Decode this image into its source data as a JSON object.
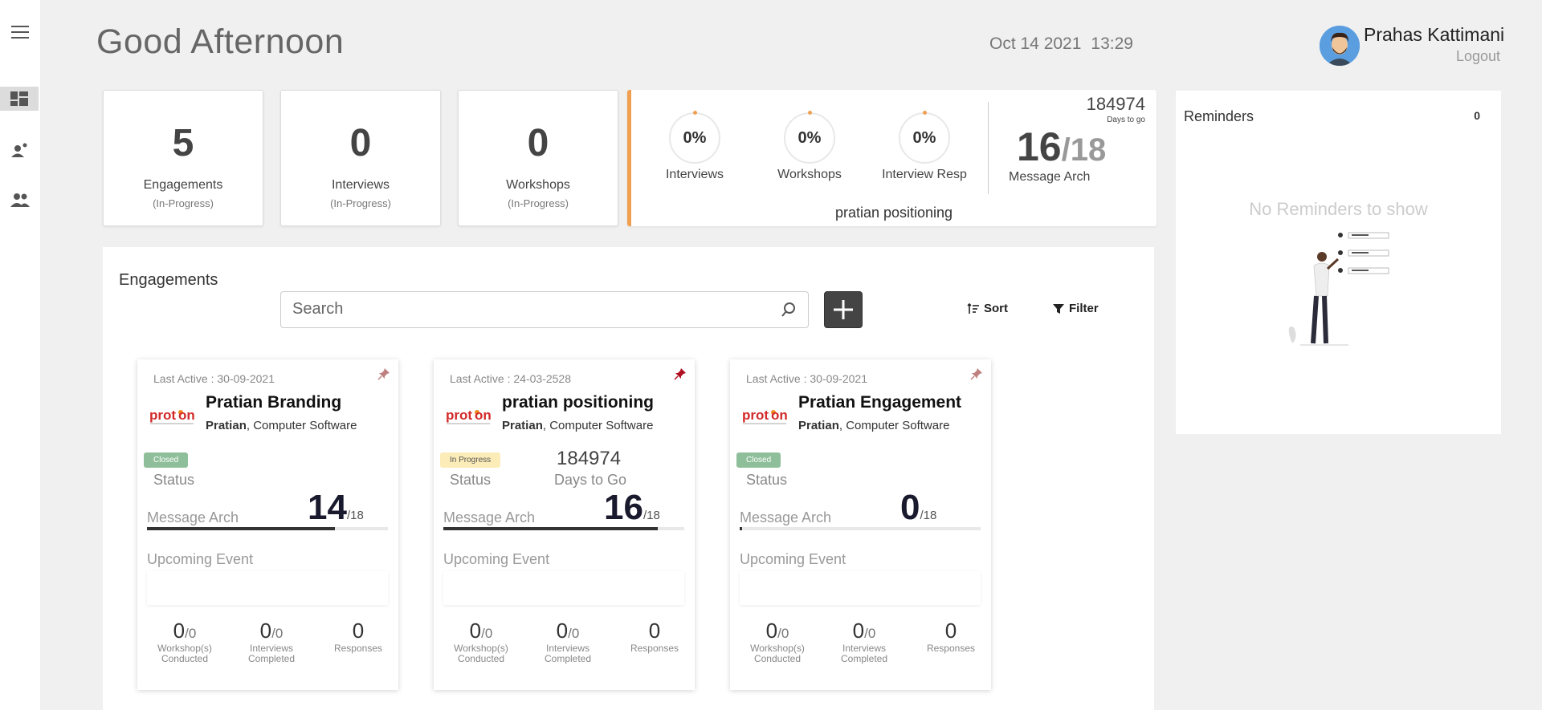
{
  "header": {
    "greeting": "Good Afternoon",
    "date": "Oct 14 2021",
    "time": "13:29",
    "user_name": "Prahas Kattimani",
    "logout_label": "Logout"
  },
  "stats": [
    {
      "value": "5",
      "label": "Engagements",
      "sub": "(In-Progress)"
    },
    {
      "value": "0",
      "label": "Interviews",
      "sub": "(In-Progress)"
    },
    {
      "value": "0",
      "label": "Workshops",
      "sub": "(In-Progress)"
    }
  ],
  "summary": {
    "rings": [
      {
        "value": "0%",
        "label": "Interviews"
      },
      {
        "value": "0%",
        "label": "Workshops"
      },
      {
        "value": "0%",
        "label": "Interview Resp"
      }
    ],
    "days_to_go": "184974",
    "days_to_go_label": "Days to go",
    "arch_num": "16",
    "arch_den": "/18",
    "arch_label": "Message Arch",
    "project_name": "pratian positioning",
    "accent_color": "#f0a050"
  },
  "engagements": {
    "title": "Engagements",
    "search_placeholder": "Search",
    "sort_label": "Sort",
    "filter_label": "Filter",
    "cards": [
      {
        "last_active": "Last Active : 30-09-2021",
        "name": "Pratian Branding",
        "company": "Pratian",
        "industry": ", Computer Software",
        "badge": "Closed",
        "status_label": "Status",
        "days": "",
        "days_label": "",
        "arch_label": "Message Arch",
        "arch_num": "14",
        "arch_den": "/18",
        "arch_progress": 0.78,
        "upcoming_label": "Upcoming Event",
        "metrics": [
          {
            "num": "0",
            "den": "/0",
            "label": "Workshop(s) Conducted"
          },
          {
            "num": "0",
            "den": "/0",
            "label": "Interviews Completed"
          },
          {
            "num": "0",
            "den": "",
            "label": "Responses"
          }
        ],
        "pin_color": "#c08080"
      },
      {
        "last_active": "Last Active : 24-03-2528",
        "name": "pratian positioning",
        "company": "Pratian",
        "industry": ", Computer Software",
        "badge": "In Progress",
        "status_label": "Status",
        "days": "184974",
        "days_label": "Days to Go",
        "arch_label": "Message Arch",
        "arch_num": "16",
        "arch_den": "/18",
        "arch_progress": 0.89,
        "upcoming_label": "Upcoming Event",
        "metrics": [
          {
            "num": "0",
            "den": "/0",
            "label": "Workshop(s) Conducted"
          },
          {
            "num": "0",
            "den": "/0",
            "label": "Interviews Completed"
          },
          {
            "num": "0",
            "den": "",
            "label": "Responses"
          }
        ],
        "pin_color": "#b01020"
      },
      {
        "last_active": "Last Active : 30-09-2021",
        "name": "Pratian Engagement",
        "company": "Pratian",
        "industry": ", Computer Software",
        "badge": "Closed",
        "status_label": "Status",
        "days": "",
        "days_label": "",
        "arch_label": "Message Arch",
        "arch_num": "0",
        "arch_den": "/18",
        "arch_progress": 0.0,
        "upcoming_label": "Upcoming Event",
        "metrics": [
          {
            "num": "0",
            "den": "/0",
            "label": "Workshop(s) Conducted"
          },
          {
            "num": "0",
            "den": "/0",
            "label": "Interviews Completed"
          },
          {
            "num": "0",
            "den": "",
            "label": "Responses"
          }
        ],
        "pin_color": "#c08080"
      }
    ]
  },
  "reminders": {
    "title": "Reminders",
    "count": "0",
    "empty_text": "No Reminders to show"
  },
  "icons": {
    "menu": "hamburger-icon",
    "dashboard": "dashboard-icon",
    "person": "person-icon",
    "group": "group-icon",
    "search": "search-icon",
    "pin": "pin-icon",
    "sort": "sort-icon",
    "filter": "filter-icon"
  }
}
